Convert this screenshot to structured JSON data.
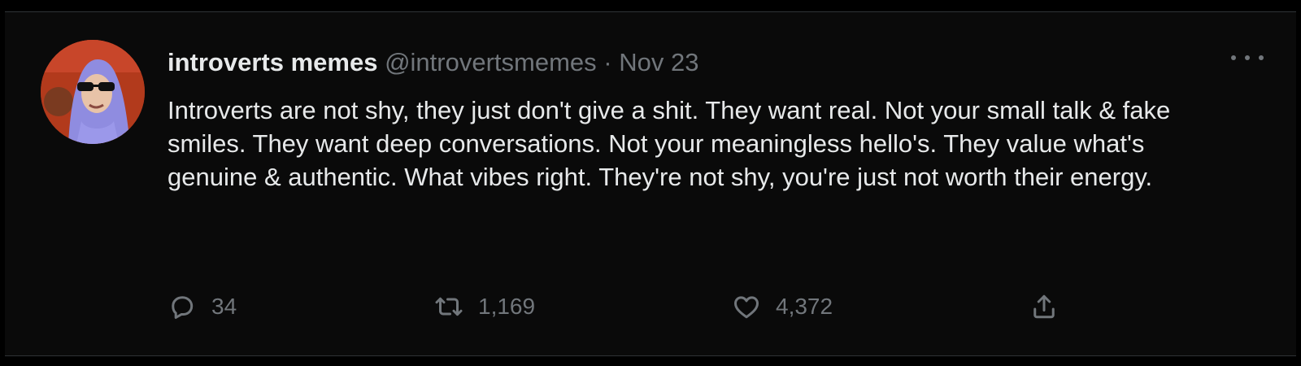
{
  "tweet": {
    "author_name": "introverts memes",
    "author_handle": "@introvertsmemes",
    "separator": "·",
    "date": "Nov 23",
    "text": "Introverts are not shy, they just don't give a shit. They want real. Not your small talk & fake smiles. They want deep conversations. Not your meaningless hello's. They value what's genuine & authentic. What vibes right. They're not shy, you're just not worth their energy.",
    "actions": {
      "reply_count": "34",
      "retweet_count": "1,169",
      "like_count": "4,372"
    }
  },
  "icons": [
    "reply-icon",
    "retweet-icon",
    "heart-icon",
    "share-icon",
    "more-icon"
  ],
  "colors": {
    "background": "#0a0a0a",
    "primary_text": "#e7e9ea",
    "secondary_text": "#71767b"
  }
}
